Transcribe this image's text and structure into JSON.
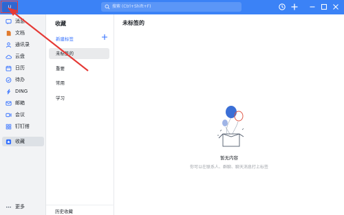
{
  "titlebar": {
    "avatar_text": "U",
    "search_placeholder": "搜索 (Ctrl+Shift+F)"
  },
  "sidebar": {
    "items": [
      {
        "label": "消息",
        "icon": "message-icon"
      },
      {
        "label": "文档",
        "icon": "document-icon"
      },
      {
        "label": "通讯录",
        "icon": "contacts-icon"
      },
      {
        "label": "云盘",
        "icon": "cloud-icon"
      },
      {
        "label": "日历",
        "icon": "calendar-icon"
      },
      {
        "label": "待办",
        "icon": "todo-icon"
      },
      {
        "label": "DING",
        "icon": "ding-icon"
      },
      {
        "label": "邮箱",
        "icon": "mail-icon"
      },
      {
        "label": "会议",
        "icon": "meeting-icon"
      },
      {
        "label": "钉钉搭",
        "icon": "dingda-icon"
      },
      {
        "label": "收藏",
        "icon": "favorite-icon"
      }
    ],
    "more_label": "更多"
  },
  "panel": {
    "title": "收藏",
    "new_tag": "新建标签",
    "items": [
      "未标签的",
      "重要",
      "常用",
      "学习"
    ],
    "footer": "历史收藏"
  },
  "main": {
    "title": "未标签的",
    "empty_title": "暂无内容",
    "empty_desc": "你可以在联系人、群聊、聊天消息打上标签"
  },
  "colors": {
    "titlebar": "#3b82f6",
    "accent": "#3370ff",
    "annotation": "#e53935"
  }
}
